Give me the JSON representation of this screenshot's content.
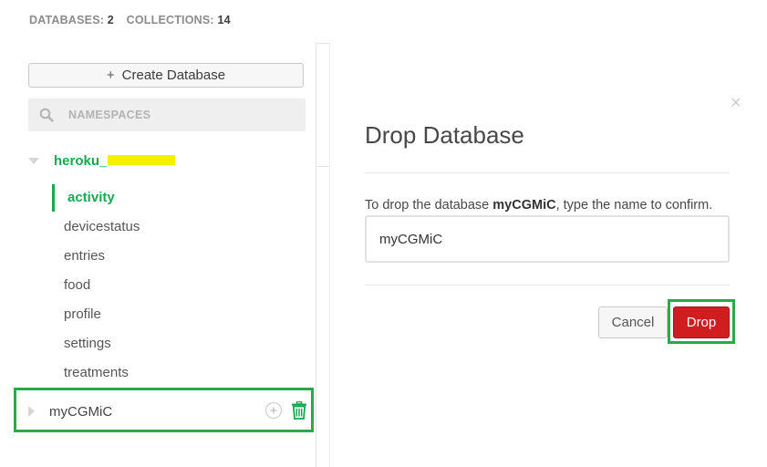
{
  "stats": {
    "databases_label": "DATABASES:",
    "databases_count": "2",
    "collections_label": "COLLECTIONS:",
    "collections_count": "14"
  },
  "sidebar": {
    "create_button_plus": "+",
    "create_button_label": "Create Database",
    "search_placeholder": "NAMESPACES",
    "databases": [
      {
        "name": "heroku_",
        "redacted": true,
        "expanded": true,
        "collections": [
          {
            "label": "activity",
            "active": true
          },
          {
            "label": "devicestatus"
          },
          {
            "label": "entries"
          },
          {
            "label": "food"
          },
          {
            "label": "profile"
          },
          {
            "label": "settings"
          },
          {
            "label": "treatments"
          }
        ]
      },
      {
        "name": "myCGMiC",
        "expanded": false
      }
    ]
  },
  "modal": {
    "close": "×",
    "title": "Drop Database",
    "confirm_prefix": "To drop the database ",
    "confirm_dbname": "myCGMiC",
    "confirm_suffix": ", type the name to confirm.",
    "input_value": "myCGMiC",
    "cancel_label": "Cancel",
    "drop_label": "Drop"
  },
  "colors": {
    "accent_green": "#13aa52",
    "highlight_green": "#2aa84a",
    "danger_red": "#cf1d20",
    "redaction_yellow": "#f4f000"
  },
  "icons": {
    "search": "search-icon",
    "add": "add-collection-icon",
    "trash": "trash-icon",
    "close": "close-icon",
    "expand": "caret-down-icon",
    "collapse": "caret-right-icon"
  }
}
